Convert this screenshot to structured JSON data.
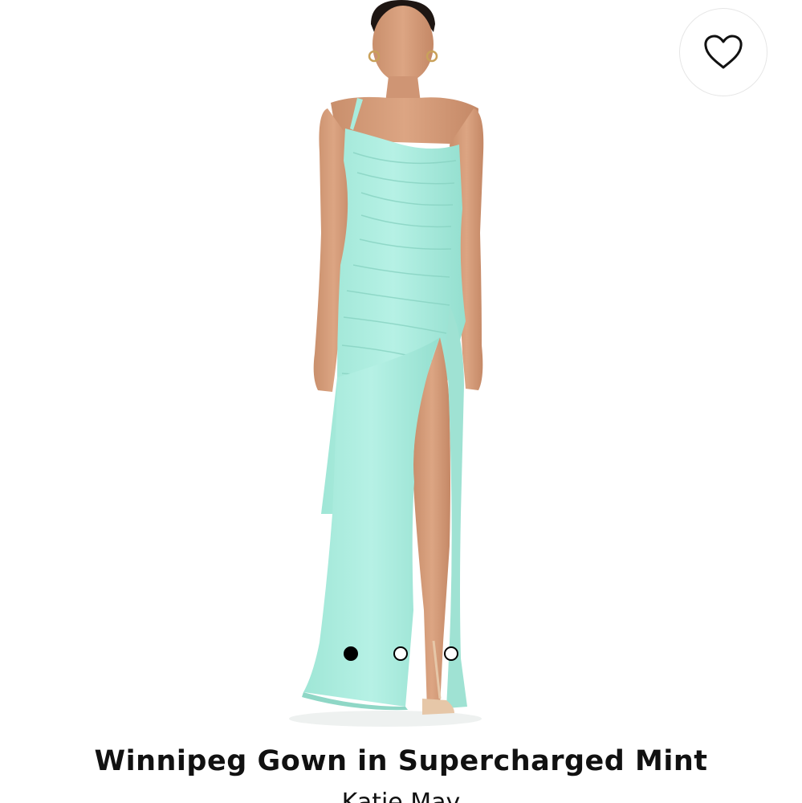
{
  "product": {
    "title": "Winnipeg Gown in Supercharged Mint",
    "brand": "Katie May",
    "dress_color": "#a8ecdd",
    "image_alt": "Model wearing mint one-shoulder gown with high slit"
  },
  "favorite": {
    "icon": "heart-outline-icon"
  },
  "carousel": {
    "total": 3,
    "active_index": 0
  }
}
